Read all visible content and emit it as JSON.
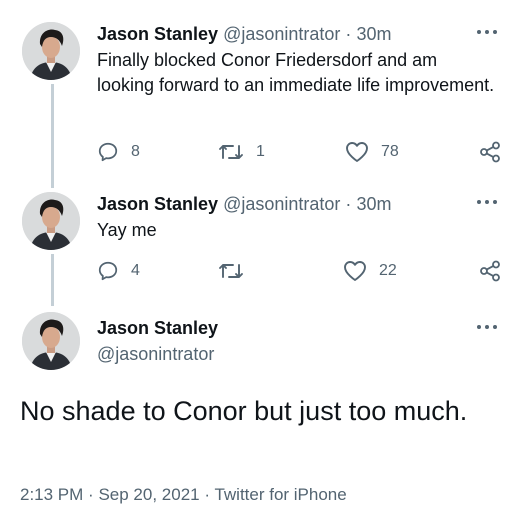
{
  "tweets": [
    {
      "author_name": "Jason Stanley",
      "author_handle": "@jasonintrator",
      "separator": "·",
      "time": "30m",
      "text": "Finally blocked Conor Friedersdorf and am looking forward to an immediate life improvement.",
      "reply_count": "8",
      "retweet_count": "1",
      "like_count": "78"
    },
    {
      "author_name": "Jason Stanley",
      "author_handle": "@jasonintrator",
      "separator": "·",
      "time": "30m",
      "text": "Yay me",
      "reply_count": "4",
      "retweet_count": "",
      "like_count": "22"
    }
  ],
  "main_tweet": {
    "author_name": "Jason Stanley",
    "author_handle": "@jasonintrator",
    "text": "No shade to Conor but just too much.",
    "time": "2:13 PM",
    "separator": "·",
    "date": "Sep 20, 2021",
    "source": "Twitter for iPhone"
  },
  "icons": {
    "avatar": "avatar",
    "more": "more-icon",
    "reply": "reply-icon",
    "retweet": "retweet-icon",
    "like": "like-icon",
    "share": "share-icon"
  },
  "colors": {
    "text": "#0f1419",
    "secondary": "#536471",
    "thread_line": "#c4cfd6",
    "background": "#ffffff"
  }
}
